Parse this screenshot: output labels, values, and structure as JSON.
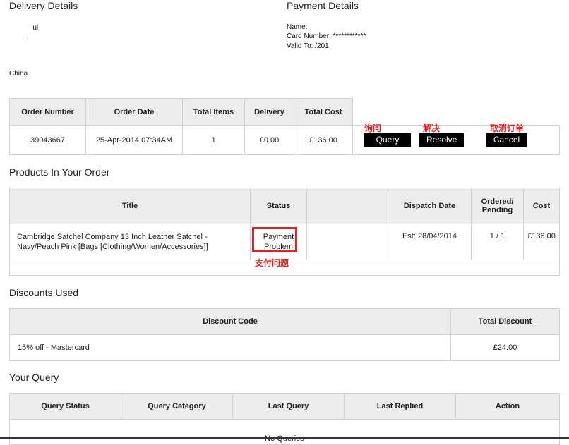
{
  "delivery": {
    "heading": "Delivery Details",
    "country": "China"
  },
  "payment": {
    "heading": "Payment Details",
    "name_label": "Name:",
    "card_label": "Card Number:",
    "card_value": "************",
    "valid_label": "Valid To:",
    "valid_value": "/201"
  },
  "order_summary": {
    "headers": [
      "Order Number",
      "Order Date",
      "Total Items",
      "Delivery",
      "Total Cost"
    ],
    "row": [
      "39043667",
      "25-Apr-2014 07:34AM",
      "1",
      "£0.00",
      "£136.00"
    ],
    "actions": [
      {
        "label": "Query",
        "annotation": "询问"
      },
      {
        "label": "Resolve",
        "annotation": "解决"
      },
      {
        "label": "Cancel",
        "annotation": "取消订单"
      }
    ]
  },
  "products": {
    "heading": "Products In Your Order",
    "headers": [
      "Title",
      "Status",
      "",
      "Dispatch Date",
      "Ordered/ Pending",
      "Cost"
    ],
    "row": {
      "title": "Cambridge Satchel Company 13 Inch Leather Satchel - Navy/Peach Pink [Bags [Clothing/Women/Accessories]]",
      "status_line1": "Payment",
      "status_line2": "Problem",
      "dispatch": "Est: 28/04/2014",
      "ordered_pending": "1 / 1",
      "cost": "£136.00"
    },
    "status_annotation": "支付问题"
  },
  "discounts": {
    "heading": "Discounts Used",
    "headers": [
      "Discount Code",
      "Total Discount"
    ],
    "row": [
      "15% off - Mastercard",
      "£24.00"
    ]
  },
  "query": {
    "heading": "Your Query",
    "headers": [
      "Query Status",
      "Query Category",
      "Last Query",
      "Last Replied",
      "Action"
    ],
    "empty_text": "No Queries"
  }
}
